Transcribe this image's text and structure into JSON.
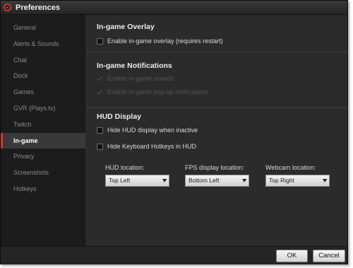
{
  "window": {
    "title": "Preferences"
  },
  "sidebar": {
    "items": [
      {
        "label": "General",
        "active": false
      },
      {
        "label": "Alerts & Sounds",
        "active": false
      },
      {
        "label": "Chat",
        "active": false
      },
      {
        "label": "Dock",
        "active": false
      },
      {
        "label": "Games",
        "active": false
      },
      {
        "label": "GVR (Plays.tv)",
        "active": false
      },
      {
        "label": "Twitch",
        "active": false
      },
      {
        "label": "In-game",
        "active": true
      },
      {
        "label": "Privacy",
        "active": false
      },
      {
        "label": "Screenshots",
        "active": false
      },
      {
        "label": "Hotkeys",
        "active": false
      }
    ]
  },
  "overlay": {
    "title": "In-game Overlay",
    "enable_label": "Enable in-game overlay (requires restart)",
    "enable_checked": false
  },
  "notifications": {
    "title": "In-game Notifications",
    "sounds_label": "Enable in-game sounds",
    "sounds_checked": true,
    "sounds_disabled": true,
    "popups_label": "Enable in-game pop-up notifications",
    "popups_checked": true,
    "popups_disabled": true
  },
  "hud": {
    "title": "HUD Display",
    "hide_inactive_label": "Hide HUD display when inactive",
    "hide_inactive_checked": false,
    "hide_hotkeys_label": "Hide Keyboard Hotkeys in HUD",
    "hide_hotkeys_checked": false,
    "hud_location_label": "HUD location:",
    "hud_location_value": "Top Left",
    "fps_location_label": "FPS display location:",
    "fps_location_value": "Bottom Left",
    "webcam_location_label": "Webcam location:",
    "webcam_location_value": "Top Right"
  },
  "footer": {
    "ok_label": "OK",
    "cancel_label": "Cancel"
  },
  "colors": {
    "accent": "#d1372c",
    "background": "#2b2b2b",
    "sidebar": "#1c1c1c"
  }
}
